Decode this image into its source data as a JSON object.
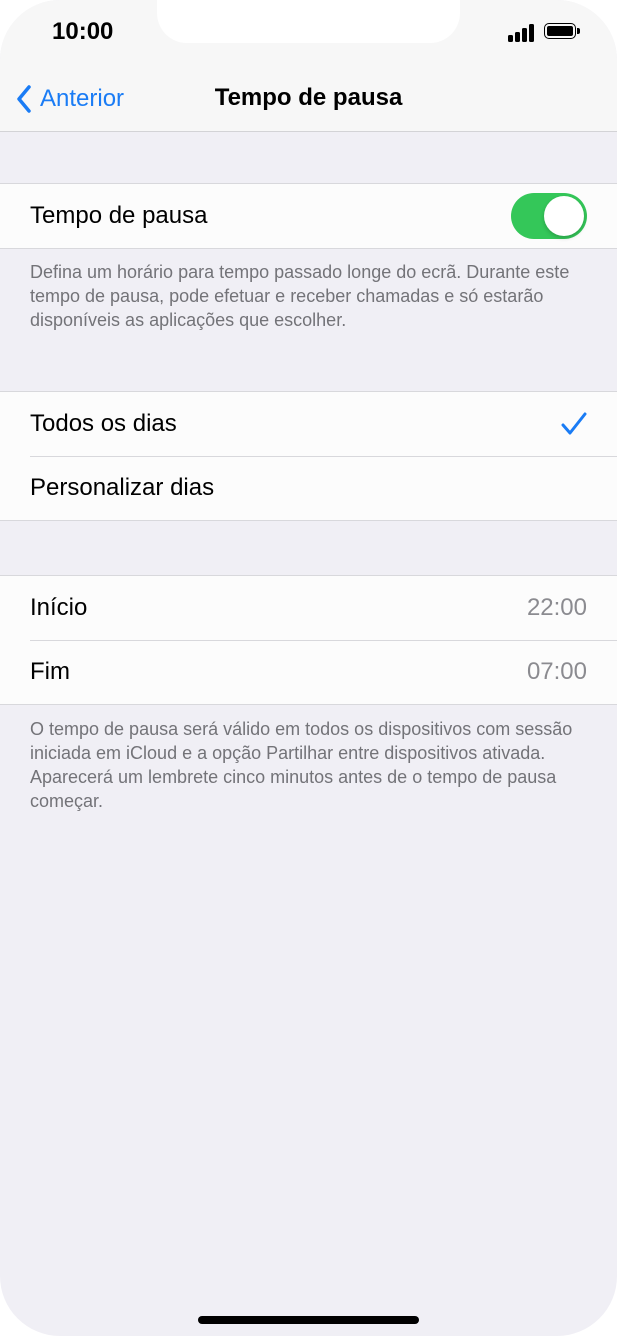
{
  "status_bar": {
    "time": "10:00"
  },
  "nav": {
    "back_label": "Anterior",
    "title": "Tempo de pausa"
  },
  "downtime": {
    "label": "Tempo de pausa",
    "enabled": true,
    "footnote": "Defina um horário para tempo passado longe do ecrã. Durante este tempo de pausa, pode efetuar e receber chamadas e só estarão disponíveis as aplicações que escolher."
  },
  "days": {
    "every_day_label": "Todos os dias",
    "every_day_selected": true,
    "custom_label": "Personalizar dias"
  },
  "schedule": {
    "start_label": "Início",
    "start_value": "22:00",
    "end_label": "Fim",
    "end_value": "07:00",
    "footnote": "O tempo de pausa será válido em todos os dispositivos com sessão iniciada em iCloud e a opção Partilhar entre dispositivos ativada. Aparecerá um lembrete cinco minutos antes de o tempo de pausa começar."
  },
  "colors": {
    "accent": "#1a7cf5",
    "toggle_on": "#34c759",
    "background": "#f0eff5"
  }
}
